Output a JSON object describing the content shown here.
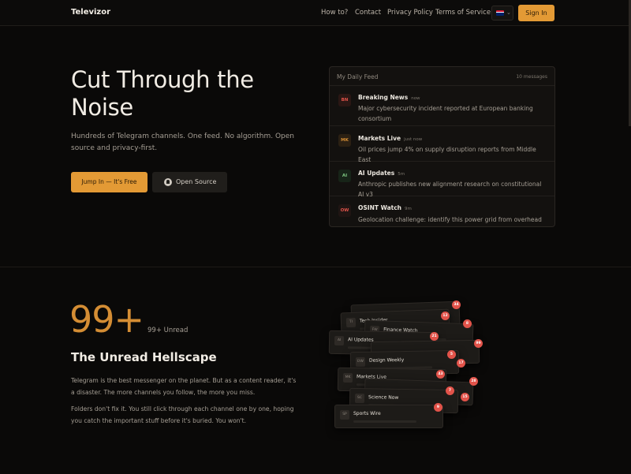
{
  "nav": {
    "brand": "Televizor",
    "links": [
      "How to?",
      "Contact",
      "Privacy Policy",
      "Terms of Service"
    ],
    "lang_flag": "uk-flag-icon",
    "sign_in": "Sign In"
  },
  "hero": {
    "title_line1": "Cut Through the",
    "title_line2": "Noise",
    "subtitle": "Hundreds of Telegram channels. One feed. No algorithm. Open source and privacy-first.",
    "primary_cta": "Jump In — It's Free",
    "secondary_cta": "Open Source",
    "secondary_icon": "github-icon"
  },
  "feed": {
    "title": "My Daily Feed",
    "count": "10 messages",
    "items": [
      {
        "abbr": "BN",
        "name": "Breaking News",
        "time": "now",
        "text": "Major cybersecurity incident reported at European banking consortium",
        "color": "#e2534a",
        "bg": "#2a1714"
      },
      {
        "abbr": "MK",
        "name": "Markets Live",
        "time": "just now",
        "text": "Oil prices jump 4% on supply disruption reports from Middle East",
        "color": "#d48d34",
        "bg": "#2b2013"
      },
      {
        "abbr": "AI",
        "name": "AI Updates",
        "time": "5m",
        "text": "Anthropic publishes new alignment research on constitutional AI v3",
        "color": "#7bc47f",
        "bg": "#172418"
      },
      {
        "abbr": "OW",
        "name": "OSINT Watch",
        "time": "9m",
        "text": "Geolocation challenge: identify this power grid from overhead",
        "color": "#e2534a",
        "bg": "#1f1513"
      }
    ]
  },
  "stats": {
    "big_number": "99+",
    "unread_label": "99+ Unread",
    "title": "The Unread Hellscape",
    "p1": "Telegram is the best messenger on the planet. But as a content reader, it's a disaster. The more channels you follow, the more you miss.",
    "p2": "Folders don't fix it. You still click through each channel one by one, hoping you catch the important stuff before it's buried. You won't."
  },
  "stack": {
    "cards": [
      {
        "abbr": "",
        "name": ""
      },
      {
        "abbr": "TI",
        "name": "Tech Insider"
      },
      {
        "abbr": "FW",
        "name": "Finance Watch"
      },
      {
        "abbr": "AI",
        "name": "AI Updates"
      },
      {
        "abbr": "",
        "name": ""
      },
      {
        "abbr": "DW",
        "name": "Design Weekly"
      },
      {
        "abbr": "MK",
        "name": "Markets Live"
      },
      {
        "abbr": "",
        "name": ""
      },
      {
        "abbr": "SC",
        "name": "Science Now"
      },
      {
        "abbr": "SP",
        "name": "Sports Wire"
      }
    ],
    "badges": [
      "34",
      "12",
      "8",
      "21",
      "99",
      "5",
      "17",
      "43",
      "28",
      "7",
      "15",
      "9"
    ]
  },
  "colors": {
    "accent": "#e39a35",
    "badge": "#e2534a",
    "background": "#0a0908"
  }
}
